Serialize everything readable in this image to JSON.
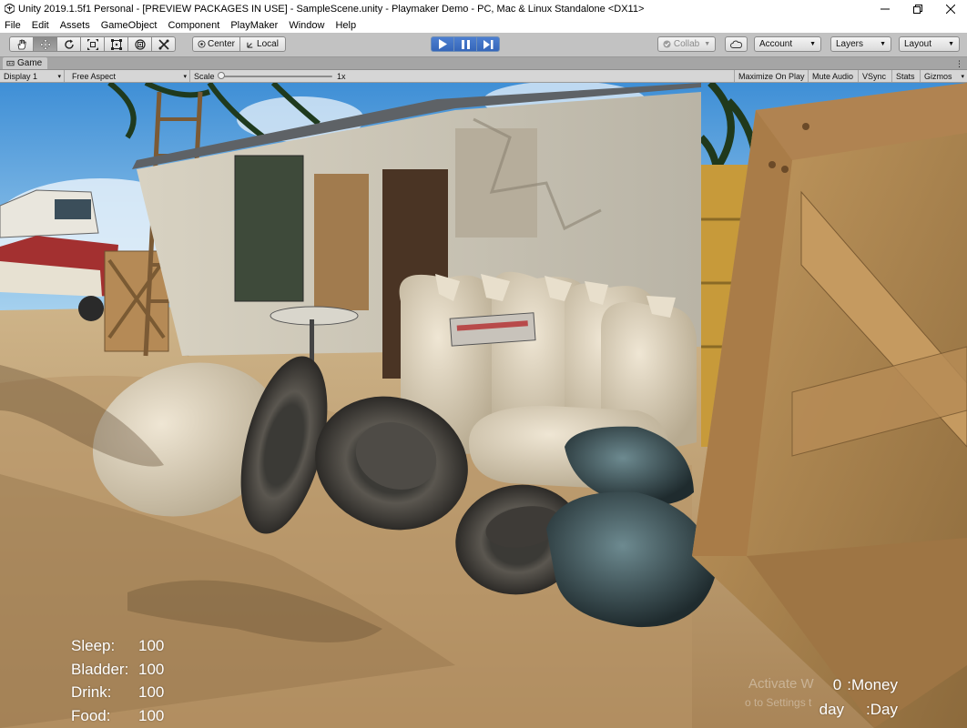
{
  "window": {
    "title": "Unity 2019.1.5f1 Personal - [PREVIEW PACKAGES IN USE] - SampleScene.unity - Playmaker Demo - PC, Mac & Linux Standalone <DX11>",
    "controls": [
      "minimize-icon",
      "maximize-icon",
      "close-icon"
    ]
  },
  "menu": {
    "items": [
      "File",
      "Edit",
      "Assets",
      "GameObject",
      "Component",
      "PlayMaker",
      "Window",
      "Help"
    ]
  },
  "toolbar": {
    "transform_tools": [
      "hand-tool-icon",
      "move-tool-icon",
      "rotate-tool-icon",
      "scale-tool-icon",
      "rect-tool-icon",
      "transform-tool-icon",
      "custom-tool-icon"
    ],
    "active_tool": "move-tool-icon",
    "pivot_mode": "Center",
    "pivot_space": "Local",
    "play_controls": [
      "play-icon",
      "pause-icon",
      "step-icon"
    ],
    "collab_label": "Collab",
    "cloud_icon": "cloud-icon",
    "account_label": "Account",
    "layers_label": "Layers",
    "layout_label": "Layout"
  },
  "game_tab": {
    "label": "Game",
    "icon": "game-view-icon"
  },
  "game_bar": {
    "display": "Display 1",
    "aspect": "Free Aspect",
    "scale_label": "Scale",
    "scale_value": "1x",
    "scale_level": 0.0,
    "maximize_on_play": "Maximize On Play",
    "mute_audio": "Mute Audio",
    "vsync": "VSync",
    "stats": "Stats",
    "gizmos": "Gizmos"
  },
  "hud": {
    "stats": [
      {
        "label": "Sleep:",
        "value": "100"
      },
      {
        "label": "Bladder:",
        "value": "100"
      },
      {
        "label": "Drink:",
        "value": "100"
      },
      {
        "label": "Food:",
        "value": "100"
      }
    ],
    "money_value": "0",
    "money_label": ":Money",
    "day_value": "day",
    "day_label": ":Day"
  },
  "watermark": {
    "line1": "Activate W",
    "line2": "o to Settings t"
  },
  "colors": {
    "play_accent": "#3a6fc4",
    "editor_gray": "#c2c2c2",
    "hud_text": "#ffffff"
  }
}
